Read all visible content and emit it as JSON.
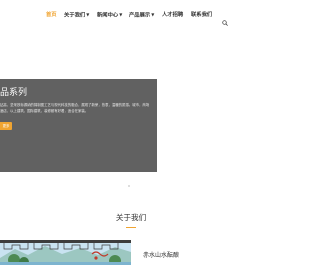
{
  "nav": {
    "items": [
      {
        "label": "首页",
        "active": true,
        "dropdown": false
      },
      {
        "label": "关于我们",
        "active": false,
        "dropdown": true
      },
      {
        "label": "新闻中心",
        "active": false,
        "dropdown": true
      },
      {
        "label": "产品展示",
        "active": false,
        "dropdown": true
      },
      {
        "label": "人才招聘",
        "active": false,
        "dropdown": false
      },
      {
        "label": "联系我们",
        "active": false,
        "dropdown": false
      }
    ],
    "search_icon": "search-icon",
    "dropdown_icon": "chevron-down-icon"
  },
  "hero": {
    "title": "品系列",
    "text": "钻高，坚采铁标源纳的锦制图工艺与现代科技的融合，展现了新荣，热衷，温暖的质感。城市，商场酒店，以上建筑，国际建筑，装修都有好看，适合在家装。",
    "button_label": "更多"
  },
  "about": {
    "title": "关于我们",
    "company_name": "赤水山水酝酿"
  },
  "colors": {
    "accent": "#f0a431",
    "text": "#333333",
    "caption_bg": "#585858"
  }
}
